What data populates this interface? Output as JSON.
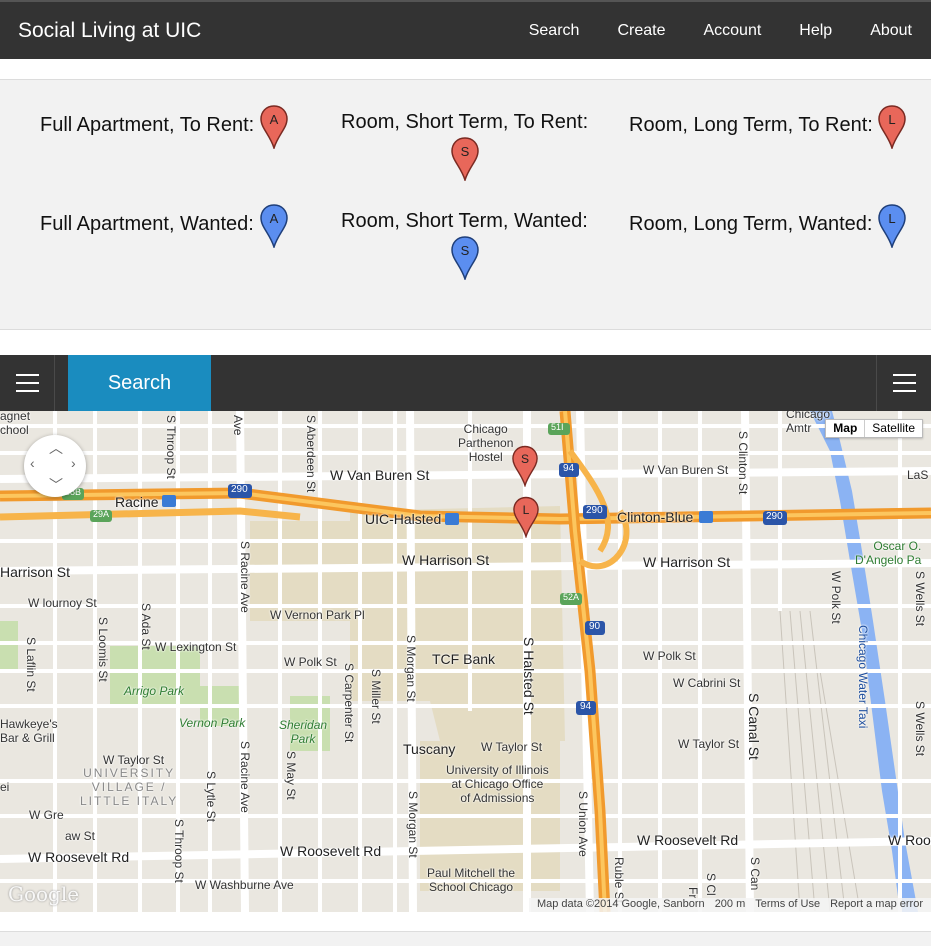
{
  "navbar": {
    "brand": "Social Living at UIC",
    "links": [
      "Search",
      "Create",
      "Account",
      "Help",
      "About"
    ]
  },
  "legend": {
    "items": [
      {
        "label": "Full Apartment, To Rent:",
        "letter": "A",
        "color": "#e8675a"
      },
      {
        "label": "Room, Short Term, To Rent:",
        "letter": "S",
        "color": "#e8675a"
      },
      {
        "label": "Room, Long Term, To Rent:",
        "letter": "L",
        "color": "#e8675a"
      },
      {
        "label": "Full Apartment, Wanted:",
        "letter": "A",
        "color": "#5b8ef0"
      },
      {
        "label": "Room, Short Term, Wanted:",
        "letter": "S",
        "color": "#5b8ef0"
      },
      {
        "label": "Room, Long Term, Wanted:",
        "letter": "L",
        "color": "#5b8ef0"
      }
    ]
  },
  "searchbar": {
    "search_label": "Search"
  },
  "map": {
    "map_type": {
      "map": "Map",
      "satellite": "Satellite"
    },
    "markers": [
      "S",
      "L"
    ],
    "labels": {
      "van_buren": "W Van Buren St",
      "van_buren_e": "W Van Buren St",
      "harrison": "W Harrison St",
      "harrison_e": "W Harrison St",
      "harrison_w": "Harrison St",
      "roosevelt": "W Roosevelt Rd",
      "roosevelt_w": "W Roosevelt Rd",
      "roosevelt_e": "W Roosevelt Rd",
      "roosevelt_far": "W Roo",
      "uic_halsted": "UIC-Halsted",
      "racine": "Racine",
      "clinton_blue": "Clinton-Blue",
      "hostel_1": "Chicago",
      "hostel_2": "Parthenon",
      "hostel_3": "Hostel",
      "vernon_park_pl": "W Vernon Park Pl",
      "lexington": "W Lexington St",
      "polk": "W Polk St",
      "polk_e": "W Polk St",
      "cabrini": "W Cabrini St",
      "taylor": "W Taylor St",
      "taylor_e": "W Taylor St",
      "taylor_w": "W Taylor St",
      "tcf_bank": "TCF Bank",
      "tuscany": "Tuscany",
      "uic_admissions_1": "University of Illinois",
      "uic_admissions_2": "at Chicago Office",
      "uic_admissions_3": "of Admissions",
      "paul_mitchell_1": "Paul Mitchell the",
      "paul_mitchell_2": "School Chicago",
      "washburne": "W Washburne Ave",
      "arrigo_park": "Arrigo Park",
      "vernon_park": "Vernon Park",
      "sheridan_park_1": "Sheridan",
      "sheridan_park_2": "Park",
      "little_italy_1": "UNIVERSITY",
      "little_italy_2": "VILLAGE /",
      "little_italy_3": "LITTLE ITALY",
      "hawkeyes_1": "Hawkeye's",
      "hawkeyes_2": "Bar & Grill",
      "oscar_1": "Oscar O.",
      "oscar_2": "D'Angelo Pa",
      "chicago_amtrak_1": "Chicago",
      "chicago_amtrak_2": "Amtr",
      "lasalle": "LaS",
      "magnet_school_1": "agnet",
      "magnet_school_2": "chool",
      "flournoy": "W  lournoy St",
      "grenshaw": "W Gre",
      "grenshaw2": "aw St",
      "throop": "S Throop St",
      "throop_s": "S Throop St",
      "aberdeen": "S Aberdeen St",
      "racine_ave": "S Racine Ave",
      "racine_ave_s": "S Racine Ave",
      "ada": "S Ada St",
      "loomis": "S Loomis St",
      "laflin": "S Laflin St",
      "carpenter": "S Carpenter St",
      "miller": "S Miller St",
      "morgan": "S Morgan St",
      "morgan_s": "S Morgan St",
      "halsted": "S Halsted St",
      "union": "S Union Ave",
      "canal": "S Canal St",
      "polk_vert": "W Polk St",
      "wells": "S Wells St",
      "wells_n": "S Wells St",
      "may": "S May St",
      "lytle": "S Lytle St",
      "clinton": "S Clinton St",
      "river": "Chicago Water Taxi",
      "ave_label": "Ave",
      "ei": "ei",
      "fr": "Fr",
      "can": "S Can",
      "scl": "S Cl",
      "ruble": "Ruble St",
      "hwy_290": "290",
      "hwy_94": "94",
      "hwy_90": "90",
      "hwy_51i": "51I",
      "hwy_52a": "52A",
      "hwy_29a": "29A",
      "hwy_58b": "58B"
    },
    "footer": {
      "data": "Map data ©2014 Google, Sanborn",
      "scale": "200 m",
      "terms": "Terms of Use",
      "report": "Report a map error"
    },
    "logo": "Google"
  }
}
